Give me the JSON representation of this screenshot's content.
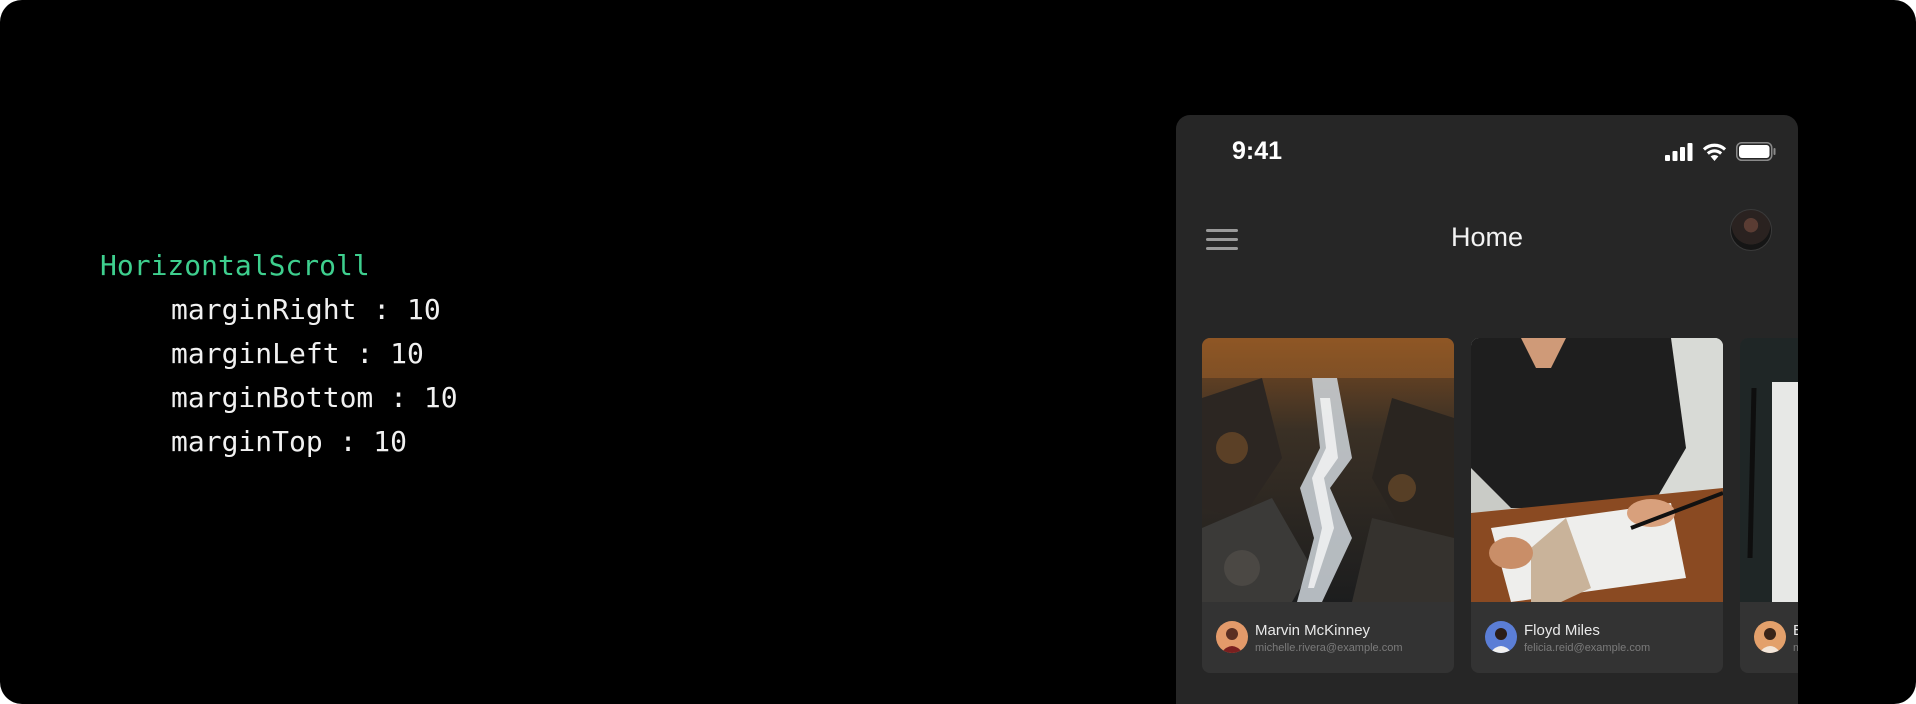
{
  "code": {
    "component": "HorizontalScroll",
    "props": [
      "marginRight : 10",
      "marginLeft : 10",
      "marginBottom : 10",
      "marginTop : 10"
    ]
  },
  "status_bar": {
    "time": "9:41",
    "icons": [
      "signal-icon",
      "wifi-icon",
      "battery-icon"
    ]
  },
  "header": {
    "title": "Home",
    "menu_icon": "hamburger-menu-icon",
    "avatar": "profile-avatar"
  },
  "cards": [
    {
      "name": "Marvin McKinney",
      "email": "michelle.rivera@example.com",
      "image": "waterfall-forest-photo"
    },
    {
      "name": "Floyd Miles",
      "email": "felicia.reid@example.com",
      "image": "person-writing-photo"
    },
    {
      "name": "E",
      "email": "m",
      "image": "notebook-pen-photo"
    }
  ],
  "colors": {
    "background": "#000000",
    "phone_background": "#262626",
    "card_background": "#333333",
    "code_accent": "#3ecf8e"
  }
}
